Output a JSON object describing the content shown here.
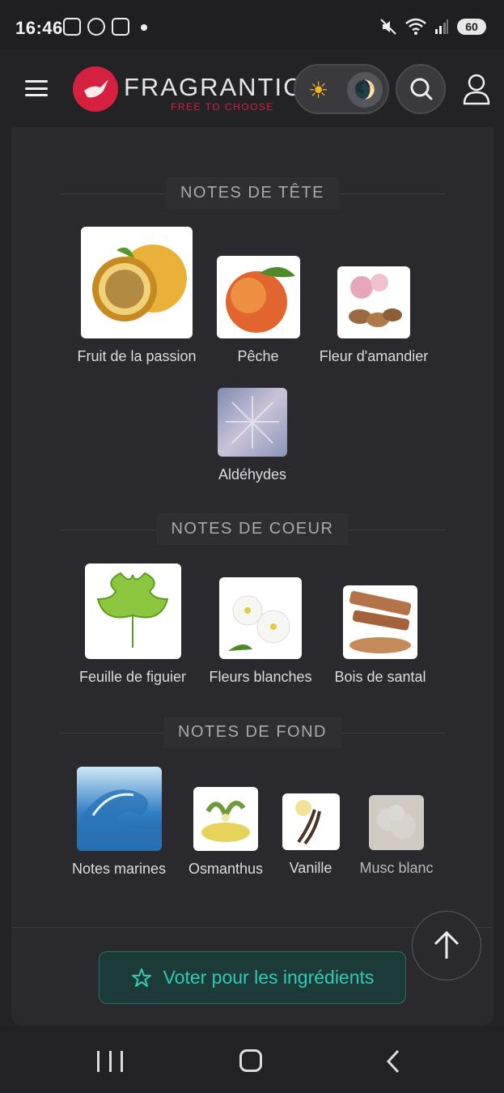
{
  "status": {
    "time": "16:46",
    "battery": "60",
    "icons_left": [
      "screenshot-icon",
      "whatsapp-icon",
      "stack-icon",
      "dot-icon"
    ],
    "icons_right": [
      "mute-icon",
      "wifi-icon",
      "signal-icon",
      "battery-icon"
    ]
  },
  "header": {
    "logo_text": "FRAGRANTICA",
    "logo_sub": "FREE TO CHOOSE",
    "sun_glyph": "☀",
    "moon_glyph": "🌒"
  },
  "sections": [
    {
      "title": "NOTES DE TÊTE",
      "notes": [
        {
          "name": "Fruit de la passion",
          "icon": "passion-fruit-image",
          "color": "#e9b13a"
        },
        {
          "name": "Pêche",
          "icon": "peach-image",
          "color": "#e2652f"
        },
        {
          "name": "Fleur d'amandier",
          "icon": "almond-blossom-image",
          "color": "#e7a7bb"
        },
        {
          "name": "Aldéhydes",
          "icon": "aldehydes-image",
          "color": "#9aa6c4"
        }
      ]
    },
    {
      "title": "NOTES DE COEUR",
      "notes": [
        {
          "name": "Feuille de figuier",
          "icon": "fig-leaf-image",
          "color": "#8cc63e"
        },
        {
          "name": "Fleurs blanches",
          "icon": "white-flowers-image",
          "color": "#f3f3f0"
        },
        {
          "name": "Bois de santal",
          "icon": "sandalwood-image",
          "color": "#b5734a"
        }
      ]
    },
    {
      "title": "NOTES DE FOND",
      "notes": [
        {
          "name": "Notes marines",
          "icon": "ocean-wave-image",
          "color": "#2f7fc4"
        },
        {
          "name": "Osmanthus",
          "icon": "osmanthus-image",
          "color": "#e7d35b"
        },
        {
          "name": "Vanille",
          "icon": "vanilla-image",
          "color": "#4a3526"
        },
        {
          "name": "Musc blanc",
          "icon": "white-musk-image",
          "color": "#ece6dc"
        }
      ]
    }
  ],
  "vote_button": {
    "label": "Voter pour les ingrédients",
    "icon": "star-outline-icon",
    "accent": "#33c9b5"
  },
  "colors": {
    "brand": "#d5203f",
    "background": "#232326",
    "card": "#2a2a2e"
  }
}
